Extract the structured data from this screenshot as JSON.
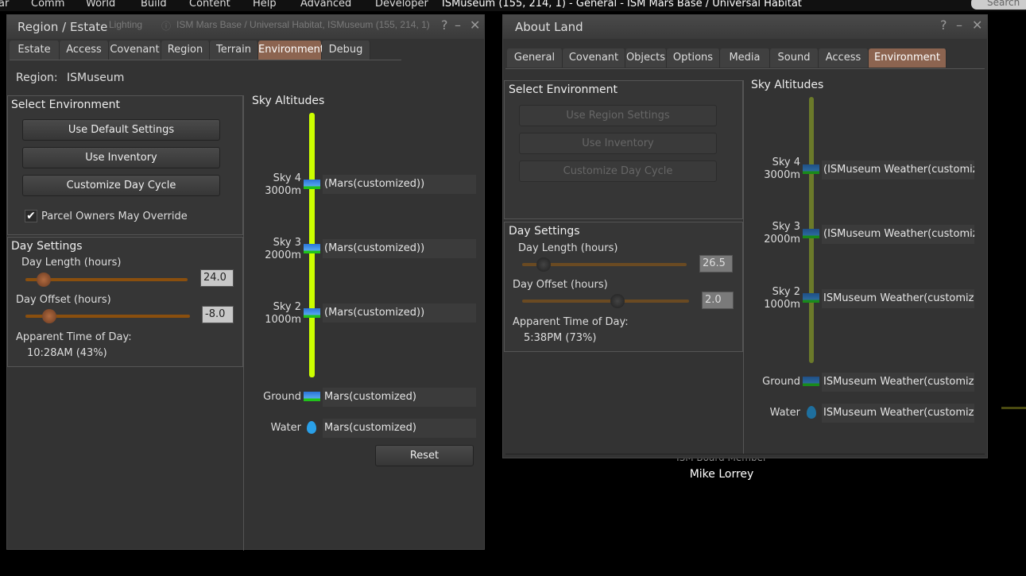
{
  "menubar": {
    "items": [
      "ar",
      "Comm",
      "World",
      "Build",
      "Content",
      "Help",
      "Advanced",
      "Developer"
    ],
    "location": "ISMuseum (155, 214, 1) - General - ISM Mars Base / Universal Habitat",
    "search_placeholder": "Search"
  },
  "background": {
    "tab1": "Lighting",
    "nav": "ISM Mars Base / Universal Habitat, ISMuseum (155, 214, 1)",
    "nameplate_title": "ISM Board Member",
    "nameplate_name": "Mike Lorrey"
  },
  "region_window": {
    "title": "Region / Estate",
    "tabs": [
      "Estate",
      "Access",
      "Covenant",
      "Region",
      "Terrain",
      "Environment",
      "Debug"
    ],
    "active_tab": "Environment",
    "region_label": "Region:",
    "region_name": "ISMuseum",
    "select_env": {
      "heading": "Select Environment",
      "buttons": [
        "Use Default Settings",
        "Use Inventory",
        "Customize Day Cycle"
      ],
      "checkbox_label": "Parcel Owners May Override",
      "checkbox_checked": true
    },
    "day": {
      "heading": "Day Settings",
      "length_label": "Day Length (hours)",
      "length_value": "24.0",
      "offset_label": "Day Offset (hours)",
      "offset_value": "-8.0",
      "apparent_label": "Apparent Time of Day:",
      "apparent_value": "10:28AM (43%)"
    },
    "sky": {
      "heading": "Sky Altitudes",
      "levels": [
        {
          "name": "Sky 4",
          "alt": "3000m",
          "value": "(Mars(customized))"
        },
        {
          "name": "Sky 3",
          "alt": "2000m",
          "value": "(Mars(customized))"
        },
        {
          "name": "Sky 2",
          "alt": "1000m",
          "value": "(Mars(customized))"
        }
      ],
      "ground_label": "Ground",
      "ground_value": "Mars(customized)",
      "water_label": "Water",
      "water_value": "Mars(customized)",
      "reset": "Reset",
      "bar_color": "#ccff00"
    }
  },
  "land_window": {
    "title": "About Land",
    "tabs": [
      "General",
      "Covenant",
      "Objects",
      "Options",
      "Media",
      "Sound",
      "Access",
      "Environment"
    ],
    "active_tab": "Environment",
    "select_env": {
      "heading": "Select Environment",
      "buttons": [
        "Use Region Settings",
        "Use Inventory",
        "Customize Day Cycle"
      ]
    },
    "day": {
      "heading": "Day Settings",
      "length_label": "Day Length (hours)",
      "length_value": "26.5",
      "offset_label": "Day Offset (hours)",
      "offset_value": "2.0",
      "apparent_label": "Apparent Time of Day:",
      "apparent_value": "5:38PM (73%)"
    },
    "sky": {
      "heading": "Sky Altitudes",
      "levels": [
        {
          "name": "Sky 4",
          "alt": "3000m",
          "value": "(ISMuseum Weather(customiz"
        },
        {
          "name": "Sky 3",
          "alt": "2000m",
          "value": "(ISMuseum Weather(customiz"
        },
        {
          "name": "Sky 2",
          "alt": "1000m",
          "value": "ISMuseum Weather(customize"
        }
      ],
      "ground_label": "Ground",
      "ground_value": "ISMuseum Weather(customize",
      "water_label": "Water",
      "water_value": "ISMuseum Weather(customize",
      "bar_color": "#6b7a2a"
    }
  },
  "colors": {
    "active_tab": "#8c6450",
    "slider_track": "#8a4f0e",
    "panel": "#333333"
  }
}
